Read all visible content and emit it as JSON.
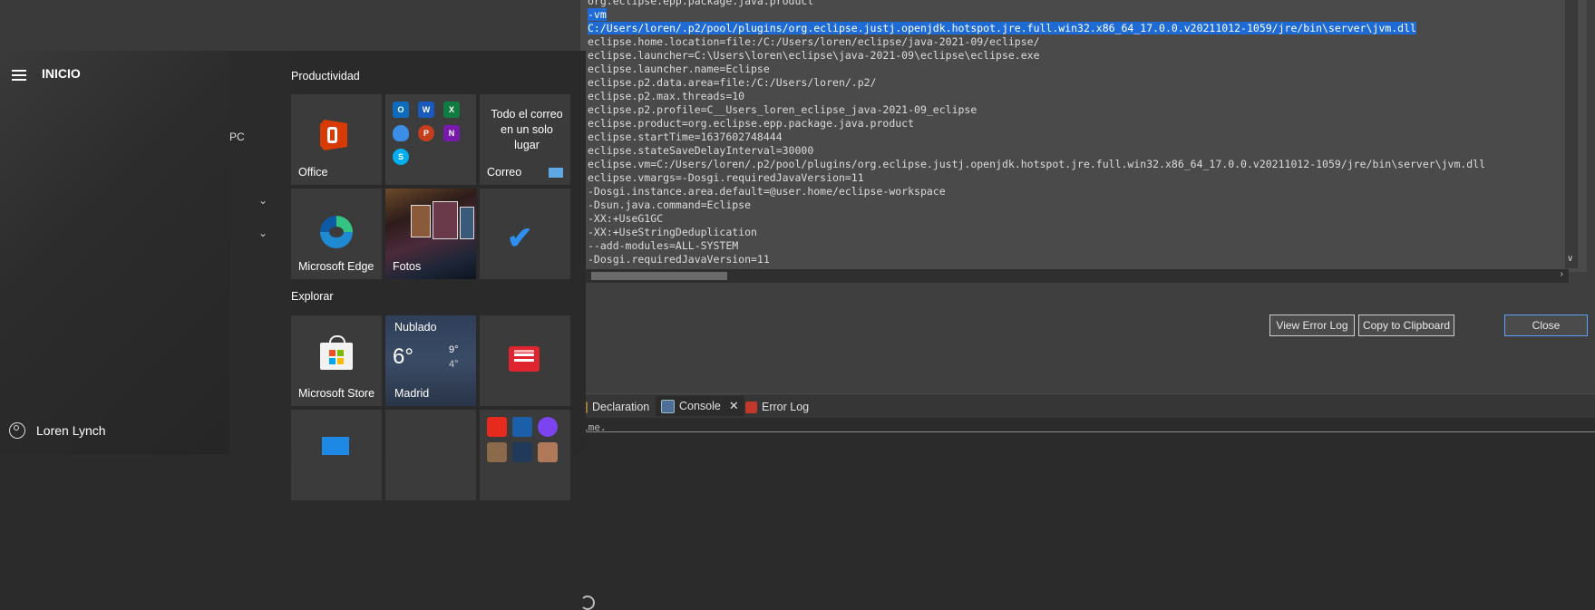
{
  "config_lines": [
    "org.eclipse.epp.package.java.product",
    "-vm",
    "C:/Users/loren/.p2/pool/plugins/org.eclipse.justj.openjdk.hotspot.jre.full.win32.x86_64_17.0.0.v20211012-1059/jre/bin\\server\\jvm.dll",
    "eclipse.home.location=file:/C:/Users/loren/eclipse/java-2021-09/eclipse/",
    "eclipse.launcher=C:\\Users\\loren\\eclipse\\java-2021-09\\eclipse\\eclipse.exe",
    "eclipse.launcher.name=Eclipse",
    "eclipse.p2.data.area=file:/C:/Users/loren/.p2/",
    "eclipse.p2.max.threads=10",
    "eclipse.p2.profile=C__Users_loren_eclipse_java-2021-09_eclipse",
    "eclipse.product=org.eclipse.epp.package.java.product",
    "eclipse.startTime=1637602748444",
    "eclipse.stateSaveDelayInterval=30000",
    "eclipse.vm=C:/Users/loren/.p2/pool/plugins/org.eclipse.justj.openjdk.hotspot.jre.full.win32.x86_64_17.0.0.v20211012-1059/jre/bin\\server\\jvm.dll",
    "eclipse.vmargs=-Dosgi.requiredJavaVersion=11",
    "-Dosgi.instance.area.default=@user.home/eclipse-workspace",
    "-Dsun.java.command=Eclipse",
    "-XX:+UseG1GC",
    "-XX:+UseStringDeduplication",
    "--add-modules=ALL-SYSTEM",
    "-Dosgi.requiredJavaVersion=11"
  ],
  "dialog": {
    "view_error_log": "View Error Log",
    "copy_to_clipboard": "Copy to Clipboard",
    "close": "Close"
  },
  "tabs": {
    "declaration": "Declaration",
    "console": "Console",
    "error_log": "Error Log"
  },
  "console_text": "ime.",
  "start_menu": {
    "title": "INICIO",
    "pc_fragment": "PC",
    "user_name": "Loren Lynch",
    "groups": {
      "productividad": "Productividad",
      "explorar": "Explorar"
    },
    "tiles": {
      "office": "Office",
      "mail_text": "Todo el correo en un solo lugar",
      "mail": "Correo",
      "edge": "Microsoft Edge",
      "fotos": "Fotos",
      "store": "Microsoft Store",
      "weather_condition": "Nublado",
      "weather_temp": "6°",
      "weather_high": "9°",
      "weather_low": "4°",
      "weather_city": "Madrid"
    },
    "mini_apps": [
      "O",
      "W",
      "X",
      "",
      "P",
      "N",
      "S"
    ]
  }
}
